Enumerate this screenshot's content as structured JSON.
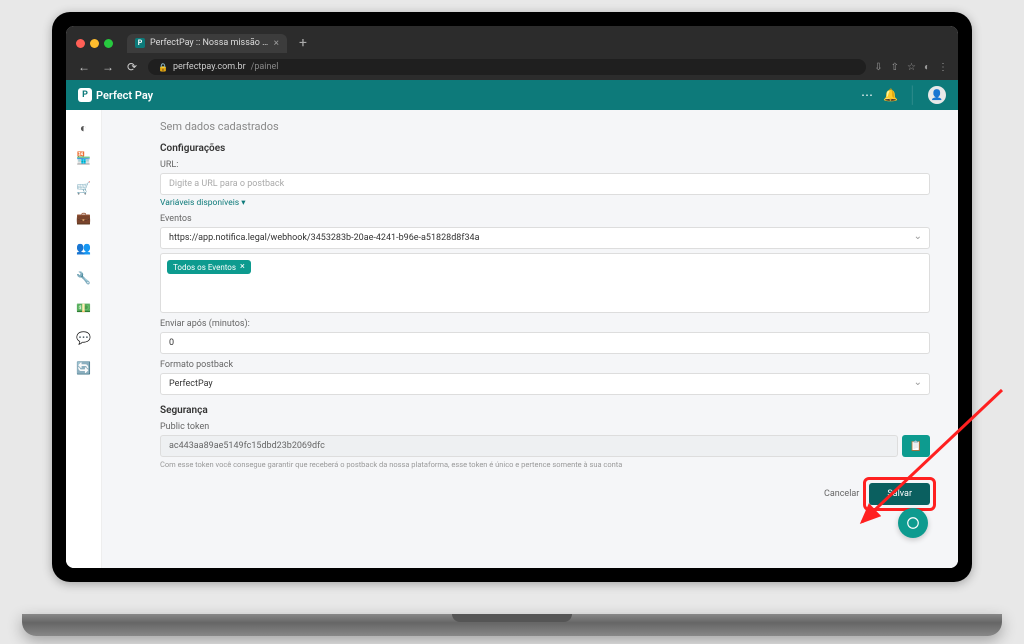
{
  "browser": {
    "tab_title": "PerfectPay :: Nossa missão é faze...",
    "url_host": "perfectpay.com.br",
    "url_path": "/painel"
  },
  "header": {
    "brand": "Perfect Pay"
  },
  "page": {
    "title": "Sem dados cadastrados",
    "config_section": "Configurações",
    "url_label": "URL:",
    "url_placeholder": "Digite a URL para o postback",
    "vars_link": "Variáveis disponíveis ▾",
    "events_label": "Eventos",
    "events_value": "https://app.notifica.legal/webhook/3453283b-20ae-4241-b96e-a51828d8f34a",
    "tag_all_events": "Todos os Eventos",
    "delay_label": "Enviar após (minutos):",
    "delay_value": "0",
    "format_label": "Formato postback",
    "format_value": "PerfectPay",
    "security_section": "Segurança",
    "token_label": "Public token",
    "token_value": "ac443aa89ae5149fc15dbd23b2069dfc",
    "token_hint": "Com esse token você consegue garantir que receberá o postback da nossa plataforma, esse token é único e pertence somente à sua conta",
    "cancel": "Cancelar",
    "save": "Salvar"
  }
}
